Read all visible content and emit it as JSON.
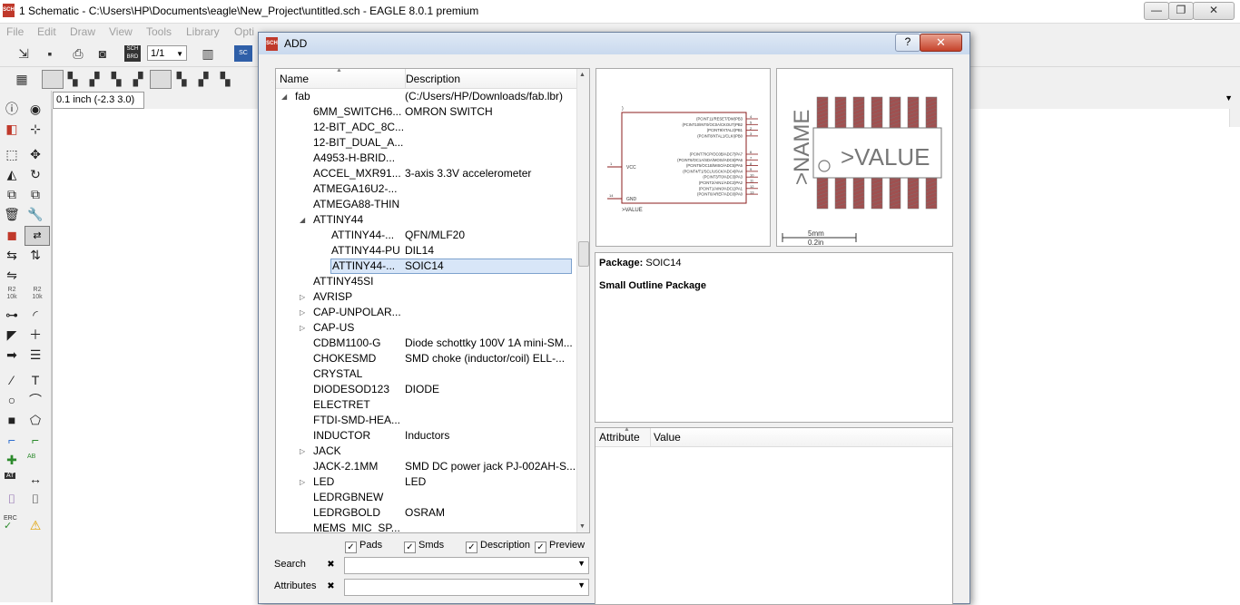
{
  "window": {
    "title": "1 Schematic - C:\\Users\\HP\\Documents\\eagle\\New_Project\\untitled.sch - EAGLE 8.0.1 premium",
    "app_icon_text": "SCH",
    "minimize_glyph": "—",
    "restore_glyph": "❐",
    "close_glyph": "✕"
  },
  "menu": [
    "File",
    "Edit",
    "Draw",
    "View",
    "Tools",
    "Library",
    "Opti"
  ],
  "toolbar": {
    "sheet_value": "1/1",
    "scbrd_label": "SCH BRD",
    "sc_label": "SC"
  },
  "coordinate": "0.1 inch (-2.3 3.0)",
  "left_tools": {
    "r2_label_1": "R2",
    "r2_sub_1": "10k",
    "r2_label_2": "R2",
    "r2_sub_2": "10k",
    "ab_label": "AB",
    "at_label": "AT",
    "erc_label": "ERC",
    "text_tool": "T"
  },
  "dialog": {
    "title": "ADD",
    "help_glyph": "?",
    "close_glyph": "✕",
    "tree": {
      "columns": [
        "Name",
        "Description"
      ],
      "rows": [
        {
          "name": "fab",
          "desc": "(C:/Users/HP/Downloads/fab.lbr)",
          "level": 0,
          "expander": "◢"
        },
        {
          "name": "6MM_SWITCH6...",
          "desc": "OMRON SWITCH",
          "level": 1,
          "expander": ""
        },
        {
          "name": "12-BIT_ADC_8C...",
          "desc": "",
          "level": 1,
          "expander": ""
        },
        {
          "name": "12-BIT_DUAL_A...",
          "desc": "",
          "level": 1,
          "expander": ""
        },
        {
          "name": "A4953-H-BRID...",
          "desc": "",
          "level": 1,
          "expander": ""
        },
        {
          "name": "ACCEL_MXR91...",
          "desc": "3-axis 3.3V accelerometer",
          "level": 1,
          "expander": ""
        },
        {
          "name": "ATMEGA16U2-...",
          "desc": "",
          "level": 1,
          "expander": ""
        },
        {
          "name": "ATMEGA88-THIN",
          "desc": "",
          "level": 1,
          "expander": ""
        },
        {
          "name": "ATTINY44",
          "desc": "",
          "level": 1,
          "expander": "◢"
        },
        {
          "name": "ATTINY44-...",
          "desc": "QFN/MLF20",
          "level": 2,
          "expander": ""
        },
        {
          "name": "ATTINY44-PU",
          "desc": "DIL14",
          "level": 2,
          "expander": ""
        },
        {
          "name": "ATTINY44-...",
          "desc": "SOIC14",
          "level": 2,
          "expander": "",
          "selected": true
        },
        {
          "name": "ATTINY45SI",
          "desc": "",
          "level": 1,
          "expander": ""
        },
        {
          "name": "AVRISP",
          "desc": "",
          "level": 1,
          "expander": "▷"
        },
        {
          "name": "CAP-UNPOLAR...",
          "desc": "",
          "level": 1,
          "expander": "▷"
        },
        {
          "name": "CAP-US",
          "desc": "",
          "level": 1,
          "expander": "▷"
        },
        {
          "name": "CDBM1100-G",
          "desc": "Diode schottky 100V 1A mini-SM...",
          "level": 1,
          "expander": ""
        },
        {
          "name": "CHOKESMD",
          "desc": "SMD choke (inductor/coil) ELL-...",
          "level": 1,
          "expander": ""
        },
        {
          "name": "CRYSTAL",
          "desc": "",
          "level": 1,
          "expander": ""
        },
        {
          "name": "DIODESOD123",
          "desc": "DIODE",
          "level": 1,
          "expander": ""
        },
        {
          "name": "ELECTRET",
          "desc": "",
          "level": 1,
          "expander": ""
        },
        {
          "name": "FTDI-SMD-HEA...",
          "desc": "",
          "level": 1,
          "expander": ""
        },
        {
          "name": "INDUCTOR",
          "desc": "Inductors",
          "level": 1,
          "expander": ""
        },
        {
          "name": "JACK",
          "desc": "",
          "level": 1,
          "expander": "▷"
        },
        {
          "name": "JACK-2.1MM",
          "desc": "SMD DC power jack PJ-002AH-S...",
          "level": 1,
          "expander": ""
        },
        {
          "name": "LED",
          "desc": "LED",
          "level": 1,
          "expander": "▷"
        },
        {
          "name": "LEDRGBNEW",
          "desc": "",
          "level": 1,
          "expander": ""
        },
        {
          "name": "LEDRGBOLD",
          "desc": "OSRAM",
          "level": 1,
          "expander": ""
        },
        {
          "name": "MEMS_MIC_SP...",
          "desc": "",
          "level": 1,
          "expander": ""
        }
      ]
    },
    "checkboxes": [
      {
        "label": "Pads",
        "checked": "✓"
      },
      {
        "label": "Smds",
        "checked": "✓"
      },
      {
        "label": "Description",
        "checked": "✓"
      },
      {
        "label": "Preview",
        "checked": "✓"
      }
    ],
    "search_label": "Search",
    "attributes_label": "Attributes",
    "clear_glyph": "✖",
    "combo_arrow": "▼",
    "symbol_preview": {
      "pins_right_a": [
        "(PCINT11/RESET/DW)PB3",
        "(PCINT10/INT0/OC0A/CKOUT)PB2",
        "(PCINT9/XTAL2)PB1",
        "(PCINT8/XTAL1/CLKI)PB0"
      ],
      "pins_right_b": [
        "(PCINT7/ICP/OC0B/ADC7)PA7",
        "(PCINT6/OC1A/SDA/MOSI/ADC6)PA6",
        "(PCINT5/OC1B/MISO/ADC5)PA5",
        "(PCINT4/T1/SCL/USCK/ADC4)PA4",
        "(PCINT3/T0/ADC3)PA3",
        "(PCINT2/AIN1/ADC2)PA2",
        "(PCINT1/AIN0/ADC1)PA1",
        "(PCINT0/AREF/ADC0)PA0"
      ],
      "pin_numbers_a": [
        "4",
        "5",
        "2",
        "3"
      ],
      "pin_numbers_b": [
        "6",
        "7",
        "8",
        "9",
        "10",
        "11",
        "12",
        "13"
      ],
      "vcc_label": "VCC",
      "gnd_label": "GND",
      "vcc_pin": "1",
      "gnd_pin": "14",
      "value_text": ">VALUE"
    },
    "package_preview": {
      "name_text": ">NAME",
      "value_text": ">VALUE",
      "scale_mm": "5mm",
      "scale_in": "0.2in",
      "pad_color": "#a05050"
    },
    "info": {
      "package_label": "Package:",
      "package_value": "SOIC14",
      "package_desc": "Small Outline Package"
    },
    "attr_table": {
      "columns": [
        "Attribute",
        "Value"
      ]
    }
  }
}
